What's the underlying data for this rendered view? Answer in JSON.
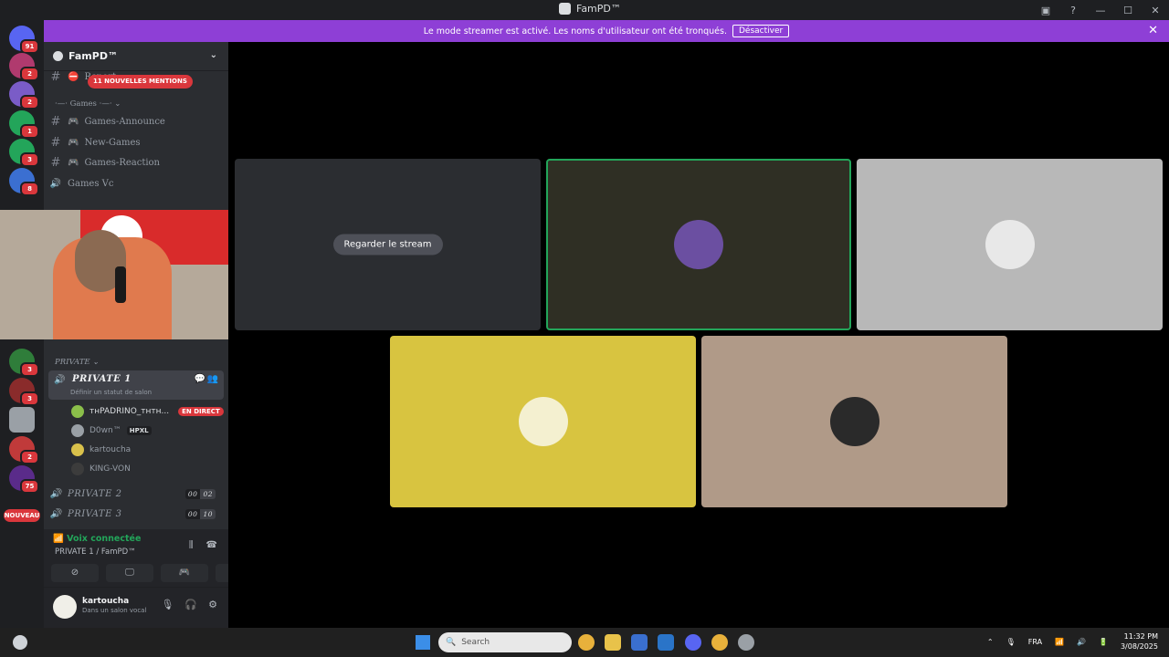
{
  "window": {
    "title": "FamPD™"
  },
  "banner": {
    "text": "Le mode streamer est activé. Les noms d'utilisateur ont été tronqués.",
    "button": "Désactiver"
  },
  "servers": [
    {
      "badge": "91",
      "color": "#5865f2"
    },
    {
      "badge": "2",
      "color": "#b03a6e"
    },
    {
      "badge": "2",
      "color": "#7a5cc7"
    },
    {
      "badge": "1",
      "color": "#23a55a"
    },
    {
      "badge": "3",
      "color": "#23a55a"
    },
    {
      "badge": "8",
      "color": "#3b6fd1"
    },
    {
      "badge": "3",
      "color": "#2f7d3a"
    },
    {
      "badge": "3",
      "color": "#8a2b2b"
    },
    {
      "badge": "",
      "color": "#9aa0a6"
    },
    {
      "badge": "2",
      "color": "#c03a3a"
    },
    {
      "badge": "75",
      "color": "#5a2b8a"
    }
  ],
  "servers_new_label": "NOUVEAU",
  "guild": {
    "name": "FamPD™"
  },
  "mentions_pill": "11 NOUVELLES MENTIONS",
  "channels": {
    "report": "Report",
    "games_category": "·—· Games ·—·",
    "text_channels": [
      "Games-Announce",
      "New-Games",
      "Games-Reaction"
    ],
    "games_vc": "Games Vc",
    "private_category": "PRIVATE",
    "private1": {
      "name": "PRIVATE 1",
      "status": "Définir un statut de salon"
    },
    "members": [
      {
        "name": "ᴛʜPADRINO_ᴛʜᴛʜ...",
        "live": "EN DIRECT",
        "color": "#8bbf4a"
      },
      {
        "name": "D0wn™",
        "tag": "HPXL",
        "color": "#9aa0a6"
      },
      {
        "name": "kartoucha",
        "color": "#d9c14b"
      },
      {
        "name": "KING-VON",
        "color": "#3c3c3c"
      }
    ],
    "private2": {
      "name": "PRIVATE 2",
      "count_a": "00",
      "count_b": "02"
    },
    "private3": {
      "name": "PRIVATE 3",
      "count_a": "00",
      "count_b": "10"
    }
  },
  "voice_panel": {
    "state": "Voix connectée",
    "location": "PRIVATE 1 / FamPD™"
  },
  "user": {
    "name": "kartoucha",
    "status": "Dans un salon vocal"
  },
  "stage": {
    "watch_button": "Regarder le stream",
    "tiles": [
      {
        "bg": "#2b2d31"
      },
      {
        "bg": "#2f2f24",
        "border": "#23a55a"
      },
      {
        "bg": "#b8b8b8"
      },
      {
        "bg": "#d8c440"
      },
      {
        "bg": "#b09a88"
      }
    ]
  },
  "taskbar": {
    "search": "Search",
    "lang": "FRA",
    "time": "11:32 PM",
    "date": "3/08/2025"
  }
}
